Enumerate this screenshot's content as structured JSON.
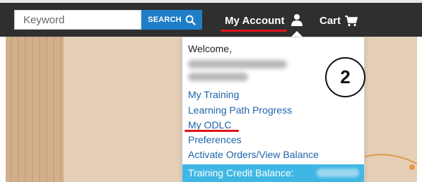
{
  "search": {
    "placeholder": "Keyword",
    "button_label": "SEARCH"
  },
  "nav": {
    "account_label": "My Account",
    "cart_label": "Cart"
  },
  "dropdown": {
    "welcome": "Welcome,",
    "items": [
      {
        "label": "My Training"
      },
      {
        "label": "Learning Path Progress"
      },
      {
        "label": "My ODLC"
      },
      {
        "label": "Preferences"
      },
      {
        "label": "Activate Orders/View Balance"
      }
    ],
    "credit_label": "Training Credit Balance:"
  },
  "annotation": {
    "step_number": "2"
  },
  "colors": {
    "navbar": "#2f2f2f",
    "search_button": "#1e7ec7",
    "link": "#1e64a8",
    "highlight_underline": "#e0141b",
    "credit_bar": "#3fb7e5"
  }
}
